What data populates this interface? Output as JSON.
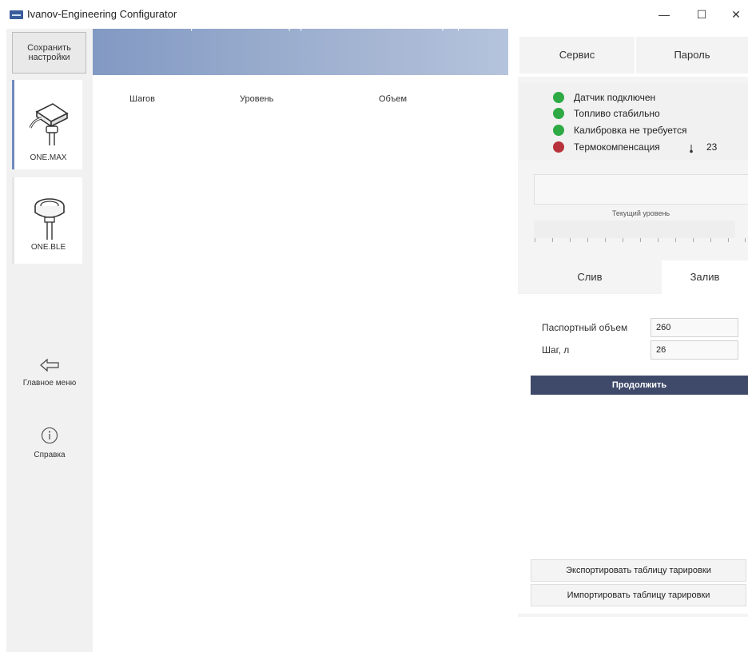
{
  "window": {
    "title": "Ivanov-Engineering Configurator",
    "minimize": "—",
    "maximize": "☐",
    "close": "✕"
  },
  "sidebar": {
    "save_label": "Сохранить настройки",
    "devices": [
      {
        "label": "ONE.MAX",
        "icon": "sensor-max-icon"
      },
      {
        "label": "ONE.BLE",
        "icon": "sensor-ble-icon"
      }
    ],
    "main_menu_label": "Главное меню",
    "help_label": "Справка"
  },
  "nav": {
    "tabs": [
      "Основные настройки",
      "Тарировка",
      "Фильтрация"
    ]
  },
  "table": {
    "columns": [
      "Шагов",
      "Уровень",
      "Объем"
    ],
    "rows": []
  },
  "right": {
    "tabs": [
      "Сервис",
      "Пароль"
    ],
    "status": [
      {
        "text": "Датчик подключен",
        "color": "#2eaa45"
      },
      {
        "text": "Топливо стабильно",
        "color": "#2eaa45"
      },
      {
        "text": "Калибровка не требуется",
        "color": "#2eaa45"
      },
      {
        "text": "Термокомпенсация",
        "color": "#b8323c"
      }
    ],
    "temperature": "23",
    "temperature_icon": "thermometer-icon",
    "level_label": "Текущий уровень",
    "sub_tabs": [
      "Слив",
      "Залив"
    ],
    "form": {
      "passport_volume_label": "Паспортный объем",
      "passport_volume_value": "260",
      "step_label": "Шаг, л",
      "step_value": "26"
    },
    "continue_label": "Продолжить",
    "export_label": "Экспортировать таблицу тарировки",
    "import_label": "Импортировать таблицу тарировки"
  },
  "colors": {
    "accent": "#3f4a6b",
    "nav_gradient_start": "#8299c3",
    "status_ok": "#2eaa45",
    "status_warn": "#b8323c"
  }
}
